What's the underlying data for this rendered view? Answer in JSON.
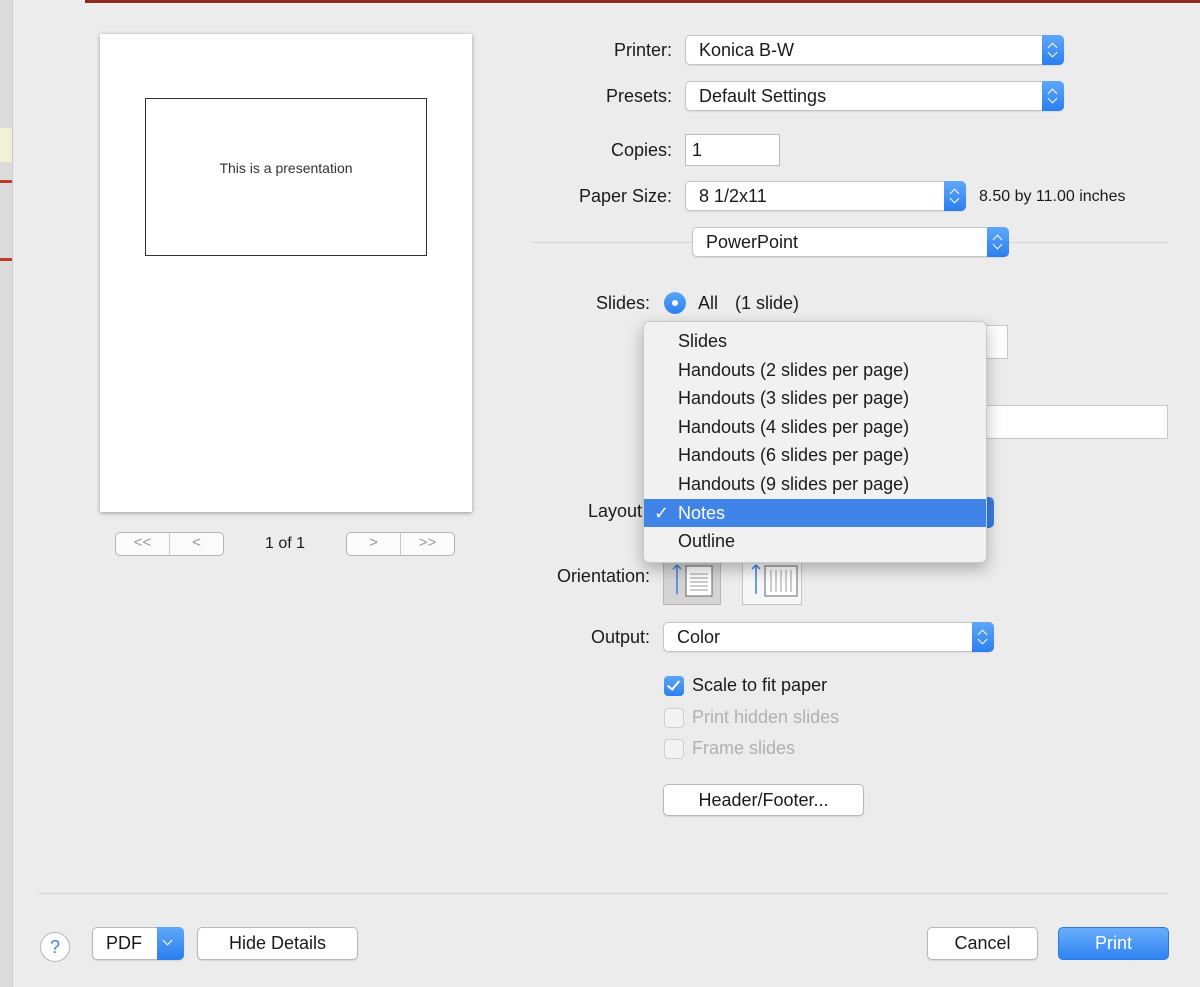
{
  "preview": {
    "slide_text": "This is a presentation",
    "page_indicator": "1 of 1",
    "pager": {
      "first": "<<",
      "prev": "<",
      "next": ">",
      "last": ">>"
    }
  },
  "printer": {
    "label": "Printer:",
    "value": "Konica B-W"
  },
  "presets": {
    "label": "Presets:",
    "value": "Default Settings"
  },
  "copies": {
    "label": "Copies:",
    "value": "1"
  },
  "paper_size": {
    "label": "Paper Size:",
    "value": "8 1/2x11",
    "info": "8.50 by 11.00 inches"
  },
  "app_section": {
    "value": "PowerPoint"
  },
  "slides": {
    "label": "Slides:",
    "option_all": "All",
    "count": "(1 slide)"
  },
  "layout": {
    "label": "Layout",
    "menu": {
      "items": [
        "Slides",
        "Handouts (2 slides per page)",
        "Handouts (3 slides per page)",
        "Handouts (4 slides per page)",
        "Handouts (6 slides per page)",
        "Handouts (9 slides per page)",
        "Notes",
        "Outline"
      ],
      "selected": "Notes",
      "check_mark": "✓"
    }
  },
  "orientation": {
    "label": "Orientation:",
    "selected": "portrait"
  },
  "output": {
    "label": "Output:",
    "value": "Color"
  },
  "checkboxes": {
    "scale_to_fit": {
      "label": "Scale to fit paper",
      "checked": true,
      "enabled": true
    },
    "print_hidden": {
      "label": "Print hidden slides",
      "checked": false,
      "enabled": false
    },
    "frame_slides": {
      "label": "Frame slides",
      "checked": false,
      "enabled": false
    }
  },
  "header_footer_button": "Header/Footer...",
  "bottom_bar": {
    "help": "?",
    "pdf": "PDF",
    "hide_details": "Hide Details",
    "cancel": "Cancel",
    "print": "Print"
  },
  "colors": {
    "accent": "#2f83f2",
    "menu_selection": "#3f84e6"
  }
}
